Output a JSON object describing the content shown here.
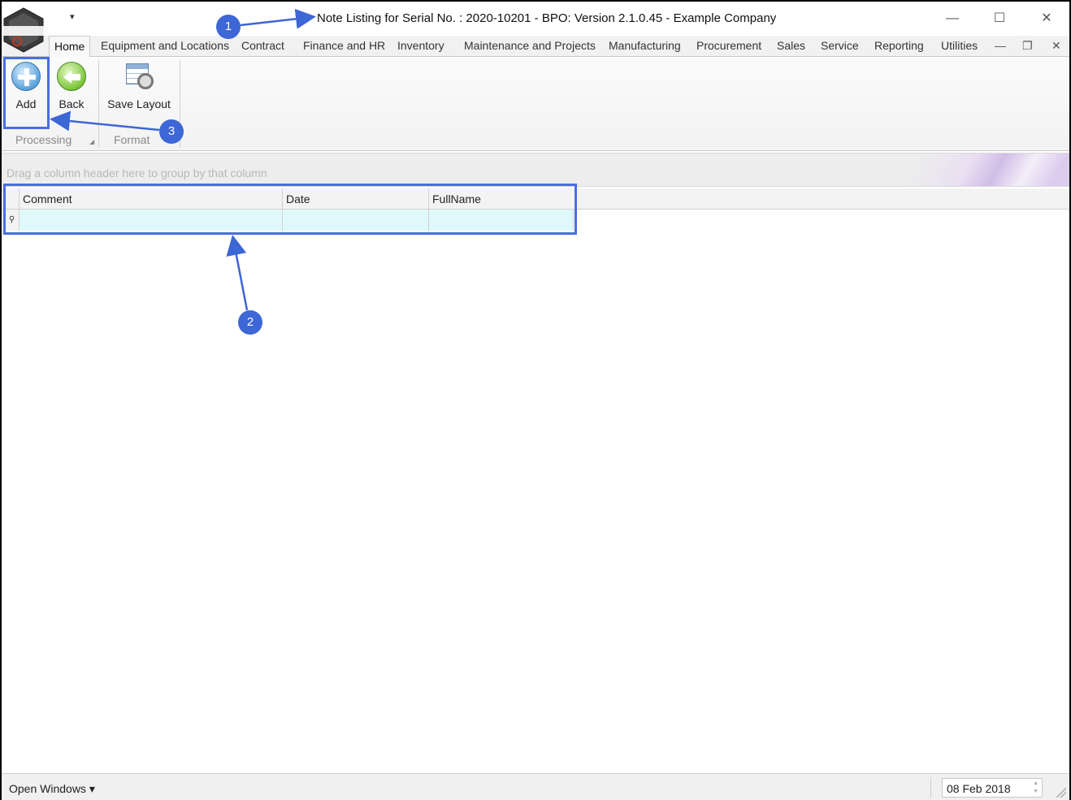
{
  "window": {
    "title": "Note Listing for Serial No. : 2020-10201 - BPO: Version 2.1.0.45 - Example Company",
    "logo_text": "bpo",
    "qat_glyph": "▾",
    "minimize": "—",
    "maximize": "☐",
    "close": "✕"
  },
  "ribbon": {
    "tabs": [
      {
        "label": "Home"
      },
      {
        "label": "Equipment and Locations"
      },
      {
        "label": "Contract"
      },
      {
        "label": "Finance and HR"
      },
      {
        "label": "Inventory"
      },
      {
        "label": "Maintenance and Projects"
      },
      {
        "label": "Manufacturing"
      },
      {
        "label": "Procurement"
      },
      {
        "label": "Sales"
      },
      {
        "label": "Service"
      },
      {
        "label": "Reporting"
      },
      {
        "label": "Utilities"
      }
    ],
    "mdi": {
      "minimize": "—",
      "restore": "❐",
      "close": "✕"
    },
    "buttons": {
      "add": "Add",
      "back": "Back",
      "save_layout": "Save Layout"
    },
    "groups": {
      "processing": "Processing",
      "format": "Format"
    }
  },
  "grid": {
    "group_hint": "Drag a column header here to group by that column",
    "columns": [
      "Comment",
      "Date",
      "FullName"
    ],
    "filter_indicator": "⚲"
  },
  "statusbar": {
    "open_windows": "Open Windows ▾",
    "date": "08 Feb 2018",
    "spin_up": "▲",
    "spin_down": "▼"
  },
  "annotations": {
    "callouts": [
      "1",
      "2",
      "3"
    ],
    "color": "#3d66d6"
  }
}
